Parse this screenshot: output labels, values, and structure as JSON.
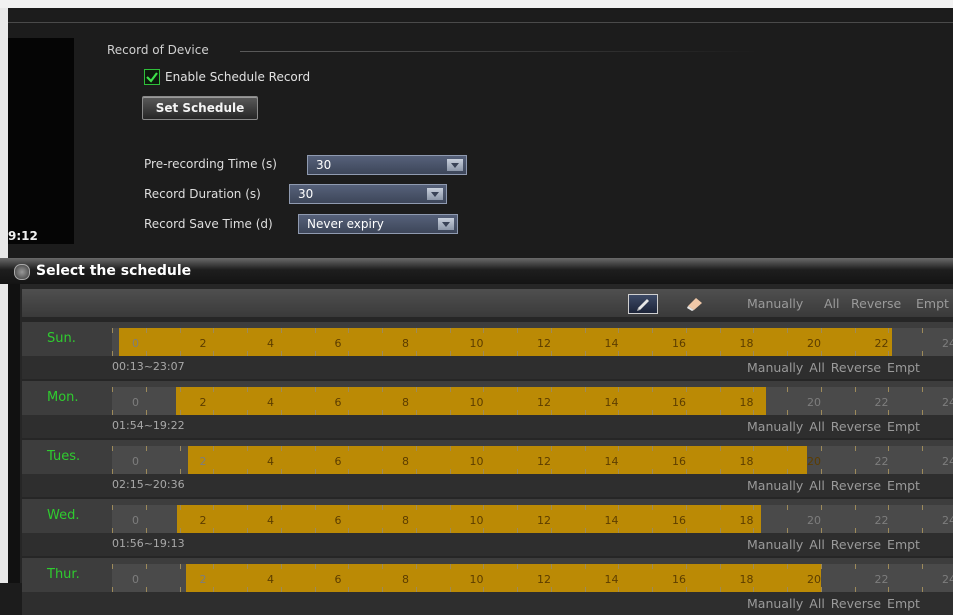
{
  "video": {
    "timestamp": "9:12"
  },
  "record": {
    "section_title": "Record of Device",
    "enable_label": "Enable Schedule Record",
    "enable_checked": true,
    "set_schedule_label": "Set Schedule",
    "prerecord_label": "Pre-recording Time (s)",
    "prerecord_value": "30",
    "duration_label": "Record Duration (s)",
    "duration_value": "30",
    "savetime_label": "Record Save Time (d)",
    "savetime_value": "Never expiry"
  },
  "schedule": {
    "title": "Select the schedule",
    "toolbar": {
      "manually": "Manually",
      "all": "All",
      "reverse": "Reverse",
      "empty": "Empt"
    },
    "days": [
      {
        "name": "Sun.",
        "range": "00:13~23:07",
        "start": 0.217,
        "end": 23.117
      },
      {
        "name": "Mon.",
        "range": "01:54~19:22",
        "start": 1.9,
        "end": 19.367
      },
      {
        "name": "Tues.",
        "range": "02:15~20:36",
        "start": 2.25,
        "end": 20.6
      },
      {
        "name": "Wed.",
        "range": "01:56~19:13",
        "start": 1.933,
        "end": 19.217
      },
      {
        "name": "Thur.",
        "range": "",
        "start": 2.2,
        "end": 21.0
      }
    ],
    "row_links": [
      "Manually",
      "All",
      "Reverse",
      "Empt"
    ],
    "hour_labels": [
      "0",
      "2",
      "4",
      "6",
      "8",
      "10",
      "12",
      "14",
      "16",
      "18",
      "20",
      "22",
      "24"
    ]
  },
  "colors": {
    "fill": "#bb8a05",
    "day_label": "#2fcc2f",
    "check": "#3de04a"
  }
}
